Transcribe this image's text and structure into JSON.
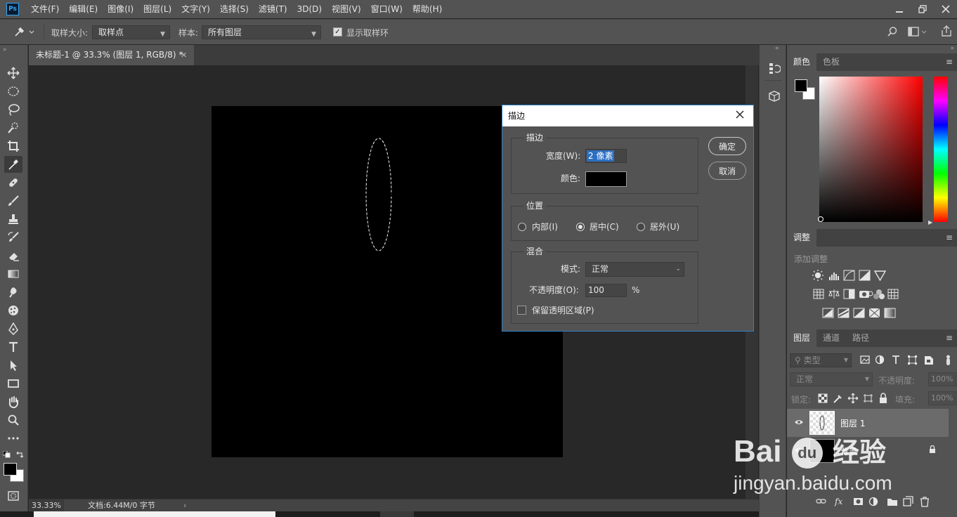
{
  "app": {
    "logo": "Ps"
  },
  "menu": [
    "文件(F)",
    "编辑(E)",
    "图像(I)",
    "图层(L)",
    "文字(Y)",
    "选择(S)",
    "滤镜(T)",
    "3D(D)",
    "视图(V)",
    "窗口(W)",
    "帮助(H)"
  ],
  "options": {
    "sample_size_label": "取样大小:",
    "sample_size_value": "取样点",
    "sample_label": "样本:",
    "sample_value": "所有图层",
    "show_ring_label": "显示取样环",
    "show_ring_checked": true
  },
  "document": {
    "tab_title": "未标题-1 @ 33.3% (图层 1, RGB/8) *",
    "zoom": "33.33%",
    "doc_info": "文档:6.44M/0 字节"
  },
  "panels": {
    "color_tabs": [
      "颜色",
      "色板"
    ],
    "adjust_tab": "调整",
    "adjust_add": "添加调整",
    "layers_tabs": [
      "图层",
      "通道",
      "路径"
    ],
    "filter_kind": "类型",
    "blend_mode": "正常",
    "opacity_label": "不透明度:",
    "opacity_value": "100%",
    "lock_label": "锁定:",
    "fill_label": "填充:",
    "fill_value": "100%",
    "layers": [
      {
        "name": "图层 1",
        "selected": true,
        "locked": false
      },
      {
        "name": "背景",
        "selected": false,
        "locked": true
      }
    ]
  },
  "dialog": {
    "title": "描边",
    "stroke_group": "描边",
    "width_label": "宽度(W):",
    "width_value": "2 像素",
    "color_label": "颜色:",
    "color_value": "#000000",
    "position_group": "位置",
    "positions": [
      "内部(I)",
      "居中(C)",
      "居外(U)"
    ],
    "position_selected": "居中(C)",
    "blend_group": "混合",
    "mode_label": "模式:",
    "mode_value": "正常",
    "opacity_label": "不透明度(O):",
    "opacity_value": "100",
    "opacity_unit": "%",
    "preserve_label": "保留透明区域(P)",
    "preserve_checked": false,
    "ok": "确定",
    "cancel": "取消"
  },
  "watermark": {
    "brand": "Bai",
    "brand_mid": "du",
    "brand_cn": "经验",
    "url": "jingyan.baidu.com"
  },
  "colors": {
    "accent": "#2f81c7",
    "chrome": "#535353",
    "canvas": "#000000",
    "pasteboard": "#282828"
  }
}
